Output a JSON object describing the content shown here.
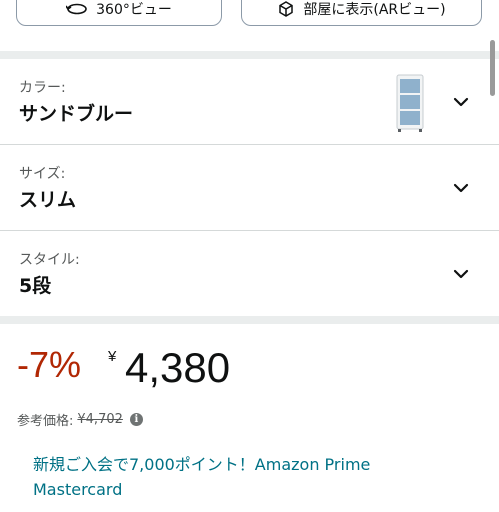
{
  "top_buttons": {
    "view360_label": "360°ビュー",
    "ar_label": "部屋に表示(ARビュー)",
    "view360_icon": "rotate-360-icon",
    "ar_icon": "ar-cube-icon"
  },
  "variations": [
    {
      "label": "カラー:",
      "value": "サンドブルー",
      "has_thumbnail": true
    },
    {
      "label": "サイズ:",
      "value": "スリム"
    },
    {
      "label": "スタイル:",
      "value": "5段"
    }
  ],
  "price": {
    "discount": "-7%",
    "currency": "¥",
    "amount": "4,380",
    "reference_label": "参考価格:",
    "reference_price": "¥4,702",
    "discount_color": "#b12704"
  },
  "promo": {
    "text": "新規ご入会で7,000ポイント！Amazon Prime Mastercard",
    "link_color": "#007185"
  }
}
